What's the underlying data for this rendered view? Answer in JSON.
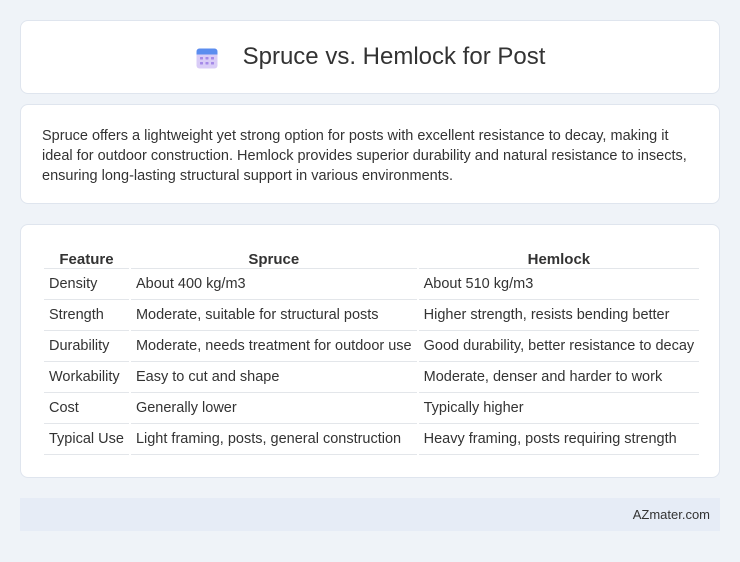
{
  "header": {
    "icon": "calendar-icon",
    "title": "Spruce vs. Hemlock for Post"
  },
  "intro": {
    "text": "Spruce offers a lightweight yet strong option for posts with excellent resistance to decay, making it ideal for outdoor construction. Hemlock provides superior durability and natural resistance to insects, ensuring long-lasting structural support in various environments."
  },
  "table": {
    "headers": [
      "Feature",
      "Spruce",
      "Hemlock"
    ],
    "rows": [
      [
        "Density",
        "About 400 kg/m3",
        "About 510 kg/m3"
      ],
      [
        "Strength",
        "Moderate, suitable for structural posts",
        "Higher strength, resists bending better"
      ],
      [
        "Durability",
        "Moderate, needs treatment for outdoor use",
        "Good durability, better resistance to decay"
      ],
      [
        "Workability",
        "Easy to cut and shape",
        "Moderate, denser and harder to work"
      ],
      [
        "Cost",
        "Generally lower",
        "Typically higher"
      ],
      [
        "Typical Use",
        "Light framing, posts, general construction",
        "Heavy framing, posts requiring strength"
      ]
    ]
  },
  "footer": {
    "brand": "AZmater.com"
  },
  "colors": {
    "background": "#eff3f8",
    "card": "#ffffff",
    "footer": "#e6ecf6",
    "icon_top": "#5b8def",
    "icon_body": "#c9b8f2"
  }
}
